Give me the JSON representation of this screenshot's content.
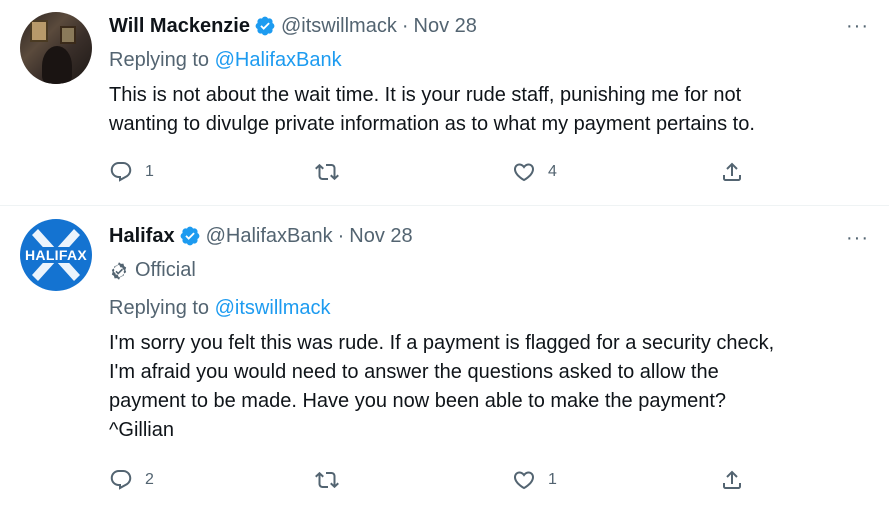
{
  "tweets": [
    {
      "name": "Will Mackenzie",
      "handle": "@itswillmack",
      "separator": "·",
      "date": "Nov 28",
      "more_label": "···",
      "replying_prefix": "Replying to",
      "replying_to": "@HalifaxBank",
      "text": "This is not about the wait time. It is your rude staff, punishing me for not\nwanting to divulge private information as to what my payment pertains to.",
      "reply_count": "1",
      "retweet_count": "",
      "like_count": "4",
      "verified_icon": "verified-badge-icon",
      "accent_color": "#1d9bf0"
    },
    {
      "name": "Halifax",
      "handle": "@HalifaxBank",
      "separator": "·",
      "date": "Nov 28",
      "more_label": "···",
      "official_label": "Official",
      "avatar_text": "HALIFAX",
      "replying_prefix": "Replying to",
      "replying_to": "@itswillmack",
      "text": "I'm sorry you felt this was rude. If a payment is flagged for a security check,\nI'm afraid you would need to answer the questions asked to allow the\npayment to be made. Have you now been able to make the payment?\n^Gillian",
      "reply_count": "2",
      "retweet_count": "",
      "like_count": "1",
      "verified_icon": "verified-badge-icon",
      "brand_color": "#1473d1"
    }
  ]
}
